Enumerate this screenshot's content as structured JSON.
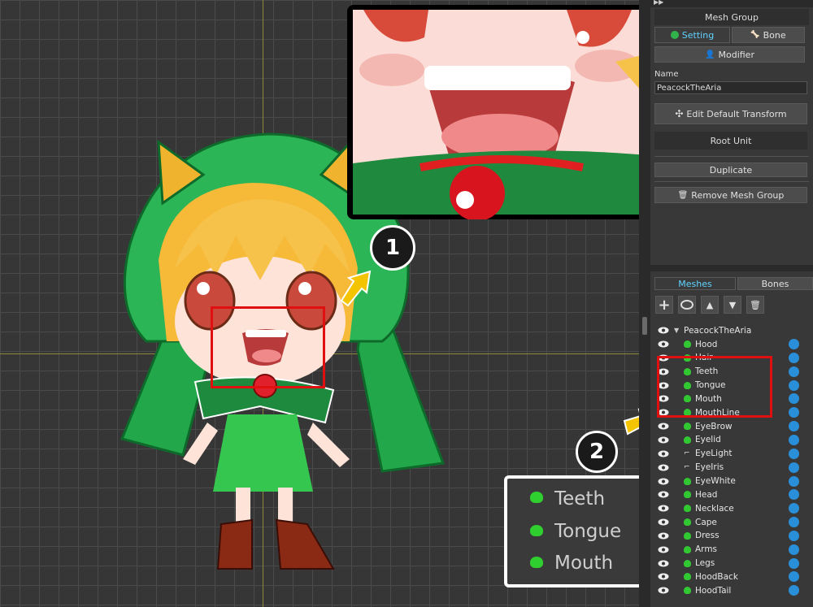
{
  "panel": {
    "title": "Mesh Group",
    "tabs": {
      "setting": "Setting",
      "bone": "Bone"
    },
    "modifier": "Modifier",
    "name_label": "Name",
    "name_value": "PeacockTheAria",
    "edit_default_transform": "Edit Default Transform",
    "root_unit": "Root Unit",
    "duplicate": "Duplicate",
    "remove": "Remove Mesh Group"
  },
  "hierarchy": {
    "tabs": {
      "meshes": "Meshes",
      "bones": "Bones"
    },
    "root": "PeacockTheAria",
    "items": [
      {
        "label": "Hood",
        "type": "mesh"
      },
      {
        "label": "Hair",
        "type": "mesh"
      },
      {
        "label": "Teeth",
        "type": "mesh"
      },
      {
        "label": "Tongue",
        "type": "mesh"
      },
      {
        "label": "Mouth",
        "type": "mesh"
      },
      {
        "label": "MouthLine",
        "type": "mesh"
      },
      {
        "label": "EyeBrow",
        "type": "mesh"
      },
      {
        "label": "Eyelid",
        "type": "mesh"
      },
      {
        "label": "EyeLight",
        "type": "group"
      },
      {
        "label": "EyeIris",
        "type": "group"
      },
      {
        "label": "EyeWhite",
        "type": "mesh"
      },
      {
        "label": "Head",
        "type": "mesh"
      },
      {
        "label": "Necklace",
        "type": "mesh"
      },
      {
        "label": "Cape",
        "type": "mesh"
      },
      {
        "label": "Dress",
        "type": "mesh"
      },
      {
        "label": "Arms",
        "type": "mesh"
      },
      {
        "label": "Legs",
        "type": "mesh"
      },
      {
        "label": "HoodBack",
        "type": "mesh"
      },
      {
        "label": "HoodTail",
        "type": "mesh"
      }
    ]
  },
  "callouts": {
    "one": "1",
    "two": "2"
  },
  "zoom_items": [
    "Teeth",
    "Tongue",
    "Mouth"
  ],
  "colors": {
    "accent_green": "#32c832",
    "highlight_red": "#e01010",
    "arrow_yellow": "#f5c400"
  },
  "icons": [
    "eye-icon",
    "mesh-icon",
    "gear-icon",
    "add-icon",
    "trash-icon",
    "arrow-up-icon",
    "arrow-down-icon"
  ]
}
